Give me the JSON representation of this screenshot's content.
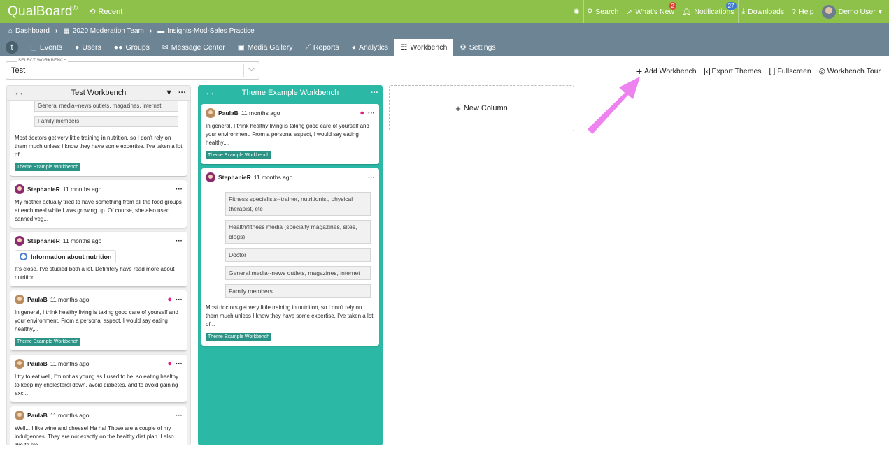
{
  "app": {
    "logo": "QualBoard",
    "logo_mark": "®"
  },
  "topbar": {
    "recent": "Recent",
    "search": "Search",
    "whats_new": "What's New",
    "whats_new_count": "2",
    "notifications": "Notifications",
    "notifications_count": "27",
    "downloads": "Downloads",
    "help": "Help",
    "user": "Demo User"
  },
  "breadcrumb": [
    "Dashboard",
    "2020 Moderation Team",
    "Insights-Mod-Sales Practice"
  ],
  "tabs": [
    "Events",
    "Users",
    "Groups",
    "Message Center",
    "Media Gallery",
    "Reports",
    "Analytics",
    "Workbench",
    "Settings"
  ],
  "workbench_select": {
    "label": "SELECT WORKBENCH",
    "value": "Test"
  },
  "toolbar": {
    "add": "Add Workbench",
    "export": "Export Themes",
    "fullscreen": "Fullscreen",
    "tour": "Workbench Tour"
  },
  "columns": {
    "test": {
      "title": "Test Workbench",
      "partial": {
        "options": [
          "General media--news outlets, magazines, internet",
          "Family members"
        ],
        "text": "Most doctors get very little training in nutrition, so I don't rely on them much unless I know they have some expertise. I've taken a lot of...",
        "tag": "Theme Example Workbench"
      },
      "cards": [
        {
          "user": "StephanieR",
          "time": "11 months ago",
          "text": "My mother actually tried to have something from all the food groups at each meal while I was growing up. Of course, she also used canned veg..."
        },
        {
          "user": "StephanieR",
          "time": "11 months ago",
          "info": "Information about nutrition",
          "text": "It's close. I've studied both a lot. Definitely have read more about nutrition."
        },
        {
          "user": "PaulaB",
          "time": "11 months ago",
          "text": "In general, I think healthy living is taking good care of yourself and your environment. From a personal aspect, I would say eating healthy,...",
          "tag": "Theme Example Workbench"
        },
        {
          "user": "PaulaB",
          "time": "11 months ago",
          "text": "I try to eat well, I'm not as young as I used to be, so eating healthy to keep my cholesterol down, avoid diabetes, and to avoid gaining exc..."
        },
        {
          "user": "PaulaB",
          "time": "11 months ago",
          "text": "Well... I like wine and cheese! Ha ha! Those are a couple of my indulgences. They are not exactly on the healthy diet plan. I also like to sle..."
        }
      ]
    },
    "theme": {
      "title": "Theme Example Workbench",
      "card1": {
        "user": "PaulaB",
        "time": "11 months ago",
        "text": "In general, I think healthy living is taking good care of yourself and your environment. From a personal aspect, I would say eating healthy,...",
        "tag": "Theme Example Workbench"
      },
      "card2": {
        "user": "StephanieR",
        "time": "11 months ago",
        "options": [
          "Fitness specialists--trainer, nutritionist, physical therapist, etc",
          "Health/fitness media (specialty magazines, sites, blogs)",
          "Doctor",
          "General media--news outlets, magazines, internet",
          "Family members"
        ],
        "text": "Most doctors get very little training in nutrition, so I don't rely on them much unless I know they have some expertise. I've taken a lot of...",
        "tag": "Theme Example Workbench"
      }
    }
  },
  "new_column": "New Column",
  "colors": {
    "brand": "#8dc14a",
    "nav": "#6c8494",
    "theme": "#2bb9a6",
    "tag": "#2b9486",
    "arrow": "#ee82ee"
  }
}
